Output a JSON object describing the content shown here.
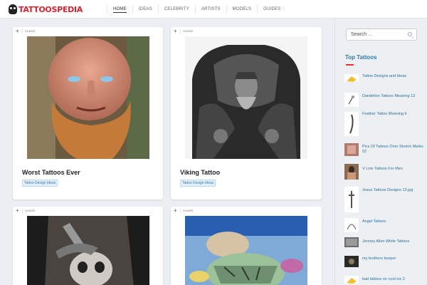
{
  "header": {
    "logo": "TATTOOSPEDIA",
    "nav": [
      "HOME",
      "IDEAS",
      "CELEBRITY",
      "ARTISTS",
      "MODELS",
      "GUIDES"
    ]
  },
  "cards": [
    {
      "share": "SHARE",
      "title": "Worst Tattoos Ever",
      "tag": "Tattoo Design Ideas"
    },
    {
      "share": "SHARE",
      "title": "Viking Tattoo",
      "tag": "Tattoo Design Ideas"
    },
    {
      "share": "SHARE"
    },
    {
      "share": "SHARE"
    }
  ],
  "sidebar": {
    "search_placeholder": "Search ...",
    "title": "Top Tattoos",
    "items": [
      {
        "label": "Tattoo Designs and Ideas"
      },
      {
        "label": "Dandelion Tattoos Meaning 13"
      },
      {
        "label": "Feather Tattoo Meaning 6"
      },
      {
        "label": "Pics Of Tattoos Over Stretch Marks 02"
      },
      {
        "label": "V Line Tattoos For Men"
      },
      {
        "label": "Jesus Tattoos Designs 13.jpg"
      },
      {
        "label": "Angel Tattoos"
      },
      {
        "label": "Jeremy Allen White Tattoos"
      },
      {
        "label": "my brothers keeper"
      },
      {
        "label": "bad tattoos mr cool ice 2"
      }
    ]
  },
  "colors": {
    "brand": "#d6232f",
    "link": "#2e6f9e",
    "accent": "#2f7bb1"
  }
}
